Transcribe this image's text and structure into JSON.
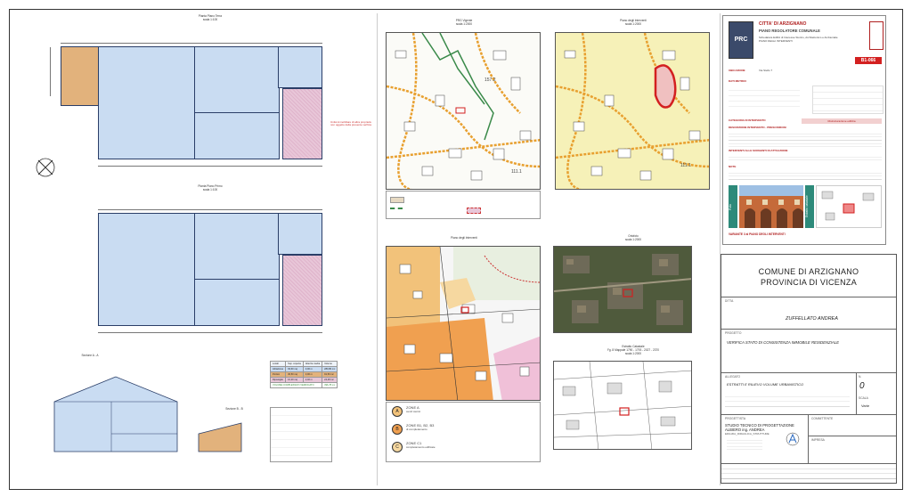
{
  "colors": {
    "blue_fill": "#c9dcf2",
    "orange_fill": "#e2b27c",
    "pink_fill": "#e8c6d8",
    "red_accent": "#d32020",
    "line_dark": "#2a3e68"
  },
  "plans": {
    "plan1_title": "Pianta Piano Terra",
    "plan1_scale": "scala 1:100",
    "plan2_title": "Pianta Piano Primo",
    "plan2_scale": "scala 1:100",
    "note_pink": "Unità immobiliare di altra proprietà non oggetto della presente verifica",
    "section_a_title": "Sezione A - A",
    "section_b_title": "Sezione B - B"
  },
  "volume_table": {
    "header": [
      "Locali",
      "Sup. coperta",
      "Altezza media",
      "Volume"
    ],
    "rows": [
      [
        "Abitazione",
        "93,60 mq",
        "3,00 m",
        "280,80 mc"
      ],
      [
        "Portico",
        "30,50 mq",
        "3,00 m",
        "91,50 mc"
      ],
      [
        "Ripostiglio",
        "10,20 mq",
        "2,40 m",
        "24,48 mc"
      ]
    ],
    "total_label": "VOLUME COMPLESSIVO VERIFICATO",
    "total_value": "396,78 mc"
  },
  "maps": {
    "prg_title": "PRG Vigente",
    "prg_scale": "scala 1:2000",
    "pi_title": "Piano degli Interventi",
    "pi_scale": "scala 1:2000",
    "ortho_title": "Ortofoto",
    "ortho_scale": "scala 1:2000",
    "cad_title": "Estratto Catastale",
    "cad_sub": "Fg. 8 Mappale 1790 - 1793 - 2027 - 2370",
    "cad_scale": "scala 1:2000",
    "val1": "157.2",
    "val2": "111.1",
    "val3": "111.1",
    "legend": [
      {
        "code": "A",
        "text": "ZONE A",
        "sub": "centri storici"
      },
      {
        "code": "B",
        "text": "ZONE B1, B2, B3",
        "sub": "di completamento"
      },
      {
        "code": "C",
        "text": "ZONE C1",
        "sub": "completamento edificate"
      }
    ]
  },
  "scheda": {
    "city": "CITTA' DI ARZIGNANO",
    "plan": "PIANO REGOLATORE COMUNALE",
    "subtitle": "Schedatura Edifici di Interesse Storico, Architettonico e Ambientale",
    "subtitle2": "PIANO DEGLI INTERVENTI",
    "code": "B1-066",
    "logo": "PRC",
    "labels": {
      "ubicazione": "UBICAZIONE",
      "dati": "DATI METRICI",
      "categoria": "CATEGORIA DI INTERVENTO",
      "descrizione": "DESCRIZIONE INTERVENTO - PRESCRIZIONI",
      "interventi": "INTERVENTI ALLE SORGENTI DI ATTUAZIONE",
      "note": "NOTE",
      "foto": "Foto",
      "estratto": "Estratto catastale"
    },
    "ubicazione_value": "Via Stello 7",
    "categoria_value": "Ristrutturazione edilizia",
    "footer": "VARIANTE 3 al PIANO DEGLI INTERVENTI"
  },
  "title_block": {
    "comune": "COMUNE DI ARZIGNANO",
    "provincia": "PROVINCIA DI VICENZA",
    "ditta_label": "DITTA",
    "ditta_value": "ZUFFELLATO ANDREA",
    "progetto_label": "PROGETTO",
    "progetto_value": "VERIFICA STATO DI CONSISTENZA IMMOBILE RESIDENZIALE",
    "allegato_label": "ALLEGATO",
    "allegato_value": "ESTRATTI E RILIEVO VOLUME URBANISTICO",
    "tav_label": "N.",
    "tav_value": "0",
    "scala_label": "SCALA",
    "scala_value": "Varie",
    "progettista_label": "PROGETTISTA",
    "studio_line1": "STUDIO TECNICO DI PROGETTAZIONE",
    "studio_line2": "ALBIERO ing. ANDREA",
    "studio_line3": "EDILIZIA_IDRAULICA_STRUTTURE",
    "committente_label": "COMMITTENTE",
    "impresa_label": "IMPRESA"
  }
}
